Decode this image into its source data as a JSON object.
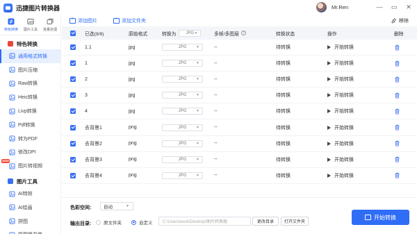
{
  "app": {
    "title": "迅捷图片转换器"
  },
  "user": {
    "name": "Mr.Ren"
  },
  "window": {
    "minimize": "—",
    "restore": "▭",
    "close": "✕"
  },
  "sidebar": {
    "top_nav": [
      {
        "label": "特色转换",
        "icon": "swap-icon",
        "active": true
      },
      {
        "label": "图片工具",
        "icon": "image-tools-icon",
        "active": false
      },
      {
        "label": "批量处理",
        "icon": "batch-icon",
        "active": false
      }
    ],
    "sections": [
      {
        "title": "特色转换",
        "items": [
          {
            "label": "通用格式转换",
            "active": true
          },
          {
            "label": "图片压缩",
            "active": false
          },
          {
            "label": "Raw转换",
            "active": false
          },
          {
            "label": "Heic转换",
            "active": false
          },
          {
            "label": "Livp转换",
            "active": false
          },
          {
            "label": "Pdf转换",
            "active": false
          },
          {
            "label": "转为PDF",
            "active": false
          },
          {
            "label": "修改DPI",
            "active": false
          },
          {
            "label": "图片转视频",
            "active": false,
            "badge": "NEW"
          }
        ]
      },
      {
        "title": "图片工具",
        "items": [
          {
            "label": "AI特效",
            "active": false
          },
          {
            "label": "AI绘画",
            "active": false
          },
          {
            "label": "拼图",
            "active": false
          },
          {
            "label": "抠图换背景",
            "active": false
          }
        ]
      }
    ]
  },
  "toolbar": {
    "add_image": "添加图片",
    "add_folder": "添加文件夹",
    "remove": "移除"
  },
  "table": {
    "headers": {
      "selected": "已选(9/9)",
      "original_format": "原始格式",
      "convert_to": "转换为",
      "convert_to_value": "JPG",
      "multi_frame": "多帧/多图层",
      "status": "转换状态",
      "action": "操作",
      "delete": "删除"
    },
    "rows": [
      {
        "name": "1.1",
        "format": "jpg",
        "target": "JPG",
        "multi": "--",
        "status": "待转换",
        "action": "开始转换"
      },
      {
        "name": "1",
        "format": "jpg",
        "target": "JPG",
        "multi": "--",
        "status": "待转换",
        "action": "开始转换"
      },
      {
        "name": "2",
        "format": "jpg",
        "target": "JPG",
        "multi": "--",
        "status": "待转换",
        "action": "开始转换"
      },
      {
        "name": "3",
        "format": "jpg",
        "target": "JPG",
        "multi": "--",
        "status": "待转换",
        "action": "开始转换"
      },
      {
        "name": "4",
        "format": "jpg",
        "target": "JPG",
        "multi": "--",
        "status": "待转换",
        "action": "开始转换"
      },
      {
        "name": "去背景1",
        "format": "png",
        "target": "JPG",
        "multi": "--",
        "status": "待转换",
        "action": "开始转换"
      },
      {
        "name": "去背景2",
        "format": "png",
        "target": "JPG",
        "multi": "--",
        "status": "待转换",
        "action": "开始转换"
      },
      {
        "name": "去背景3",
        "format": "png",
        "target": "JPG",
        "multi": "--",
        "status": "待转换",
        "action": "开始转换"
      },
      {
        "name": "去背景4",
        "format": "png",
        "target": "JPG",
        "multi": "--",
        "status": "待转换",
        "action": "开始转换"
      }
    ]
  },
  "bottom": {
    "color_space_label": "色彩空间:",
    "color_space_value": "自动",
    "output_dir_label": "输出目录:",
    "radio_source": "原文件夹",
    "radio_custom": "自定义",
    "path": "C:\\Users\\work\\Desktop\\图片转换器",
    "change_dir": "更改目录",
    "open_folder": "打开文件夹",
    "start_all": "开始转换"
  },
  "colors": {
    "accent": "#2f6df6",
    "new_badge": "#f34b3b",
    "section_red": "#e9483b"
  }
}
